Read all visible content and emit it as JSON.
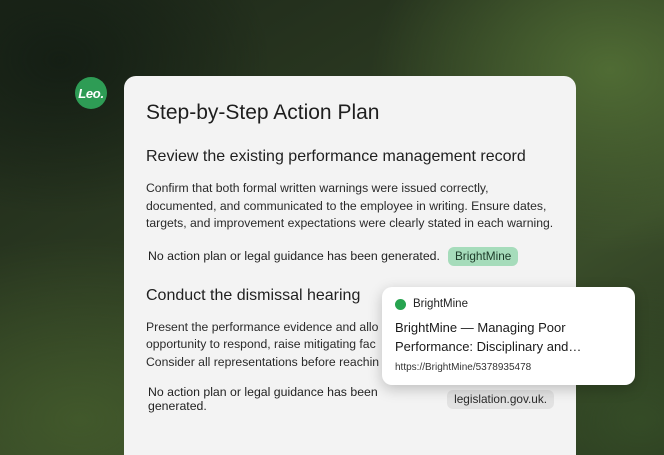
{
  "assistant": {
    "avatar_text": "Leo."
  },
  "card": {
    "title": "Step-by-Step Action Plan",
    "steps": [
      {
        "heading": "Review the existing performance management record",
        "body": "Confirm that both formal written warnings were issued correctly, documented, and communicated to the employee in writing. Ensure dates, targets, and improvement expectations were clearly stated in each warning.",
        "guidance_text": "No action plan or legal guidance has been generated.",
        "source_label": "BrightMine"
      },
      {
        "heading": "Conduct the dismissal hearing",
        "body_lines": [
          "Present the performance evidence and allo",
          "opportunity to respond, raise mitigating fac",
          "Consider all representations before reachin"
        ],
        "guidance_text": "No action plan or legal guidance has been generated.",
        "source_label": "legislation.gov.uk."
      }
    ]
  },
  "tooltip": {
    "source": "BrightMine",
    "title": "BrightMine — Managing Poor Performance: Disciplinary and Dismissal",
    "url": "https://BrightMine/5378935478"
  },
  "colors": {
    "accent_green": "#2e9c55",
    "chip_green": "#a6dcbb",
    "chip_grey": "#e2e2e2",
    "card_background": "#f3f3f3"
  }
}
